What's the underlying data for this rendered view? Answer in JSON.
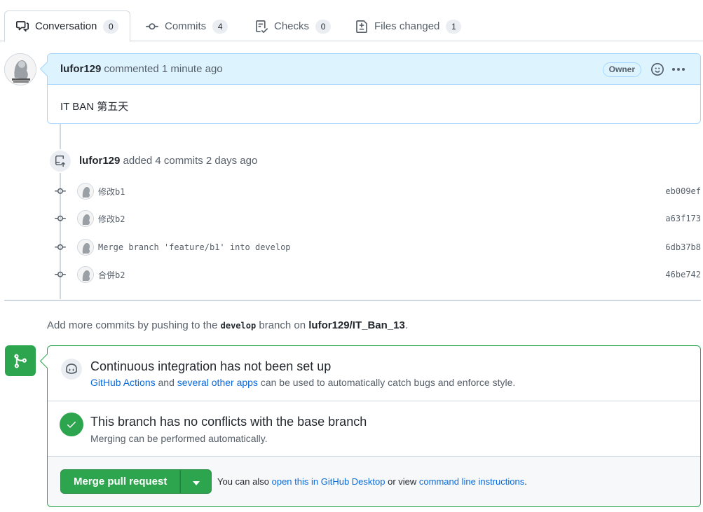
{
  "tabs": [
    {
      "label": "Conversation",
      "count": "0",
      "icon": "comment-discussion-icon"
    },
    {
      "label": "Commits",
      "count": "4",
      "icon": "git-commit-icon"
    },
    {
      "label": "Checks",
      "count": "0",
      "icon": "checklist-icon"
    },
    {
      "label": "Files changed",
      "count": "1",
      "icon": "file-diff-icon"
    }
  ],
  "comment": {
    "author": "lufor129",
    "action": "commented",
    "time": "1 minute ago",
    "badge": "Owner",
    "body": "IT BAN 第五天"
  },
  "push_event": {
    "author": "lufor129",
    "text": "added 4 commits 2 days ago"
  },
  "commits": [
    {
      "message": "修改b1",
      "sha": "eb009ef"
    },
    {
      "message": "修改b2",
      "sha": "a63f173"
    },
    {
      "message": "Merge branch 'feature/b1' into develop",
      "sha": "6db37b8"
    },
    {
      "message": "合併b2",
      "sha": "46be742"
    }
  ],
  "hint": {
    "prefix": "Add more commits by pushing to the",
    "branch": "develop",
    "middle": "branch on",
    "repo": "lufor129/IT_Ban_13",
    "suffix": "."
  },
  "ci": {
    "title": "Continuous integration has not been set up",
    "link1": "GitHub Actions",
    "and": "and",
    "link2": "several other apps",
    "rest": "can be used to automatically catch bugs and enforce style."
  },
  "conflicts": {
    "title": "This branch has no conflicts with the base branch",
    "sub": "Merging can be performed automatically."
  },
  "merge": {
    "button": "Merge pull request",
    "also_prefix": "You can also",
    "link_desktop": "open this in GitHub Desktop",
    "or_view": "or view",
    "link_cli": "command line instructions",
    "suffix": "."
  },
  "colors": {
    "accent_green": "#2da44e",
    "link_blue": "#0969da",
    "comment_header_bg": "#ddf4ff"
  }
}
